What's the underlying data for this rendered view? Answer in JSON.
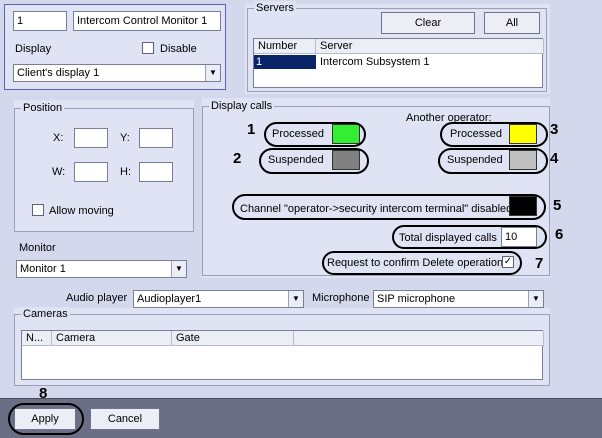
{
  "identity": {
    "id_value": "1",
    "name_value": "Intercom Control Monitor 1"
  },
  "display": {
    "label": "Display",
    "disable_label": "Disable",
    "disable_checked": false,
    "selected": "Client's display 1"
  },
  "servers": {
    "title": "Servers",
    "clear_label": "Clear",
    "all_label": "All",
    "columns": [
      "Number",
      "Server"
    ],
    "rows": [
      {
        "number": "1",
        "server": "Intercom Subsystem 1"
      }
    ]
  },
  "position": {
    "title": "Position",
    "x_label": "X:",
    "y_label": "Y:",
    "w_label": "W:",
    "h_label": "H:",
    "x_value": "",
    "y_value": "",
    "w_value": "",
    "h_value": "",
    "allow_moving_label": "Allow moving",
    "allow_moving_checked": false
  },
  "display_calls": {
    "title": "Display calls",
    "another_operator_label": "Another operator:",
    "processed_label": "Processed",
    "suspended_label": "Suspended",
    "other_processed_label": "Processed",
    "other_suspended_label": "Suspended",
    "channel_label": "Channel \"operator->security intercom terminal\" disabled",
    "total_label": "Total displayed calls",
    "total_value": "10",
    "confirm_delete_label": "Request to confirm Delete operation",
    "confirm_delete_checked": true,
    "colors": {
      "processed": "#33ee33",
      "suspended": "#808080",
      "other_processed": "#ffff00",
      "other_suspended": "#c0c0c0",
      "channel": "#000000"
    }
  },
  "monitor": {
    "label": "Monitor",
    "selected": "Monitor 1"
  },
  "audio": {
    "player_label": "Audio player",
    "player_selected": "Audioplayer1",
    "mic_label": "Microphone",
    "mic_selected": "SIP microphone"
  },
  "cameras": {
    "title": "Cameras",
    "columns": [
      "N...",
      "Camera",
      "Gate"
    ]
  },
  "footer": {
    "apply_label": "Apply",
    "cancel_label": "Cancel"
  },
  "annotations": {
    "m1": "1",
    "m2": "2",
    "m3": "3",
    "m4": "4",
    "m5": "5",
    "m6": "6",
    "m7": "7",
    "m8": "8"
  }
}
